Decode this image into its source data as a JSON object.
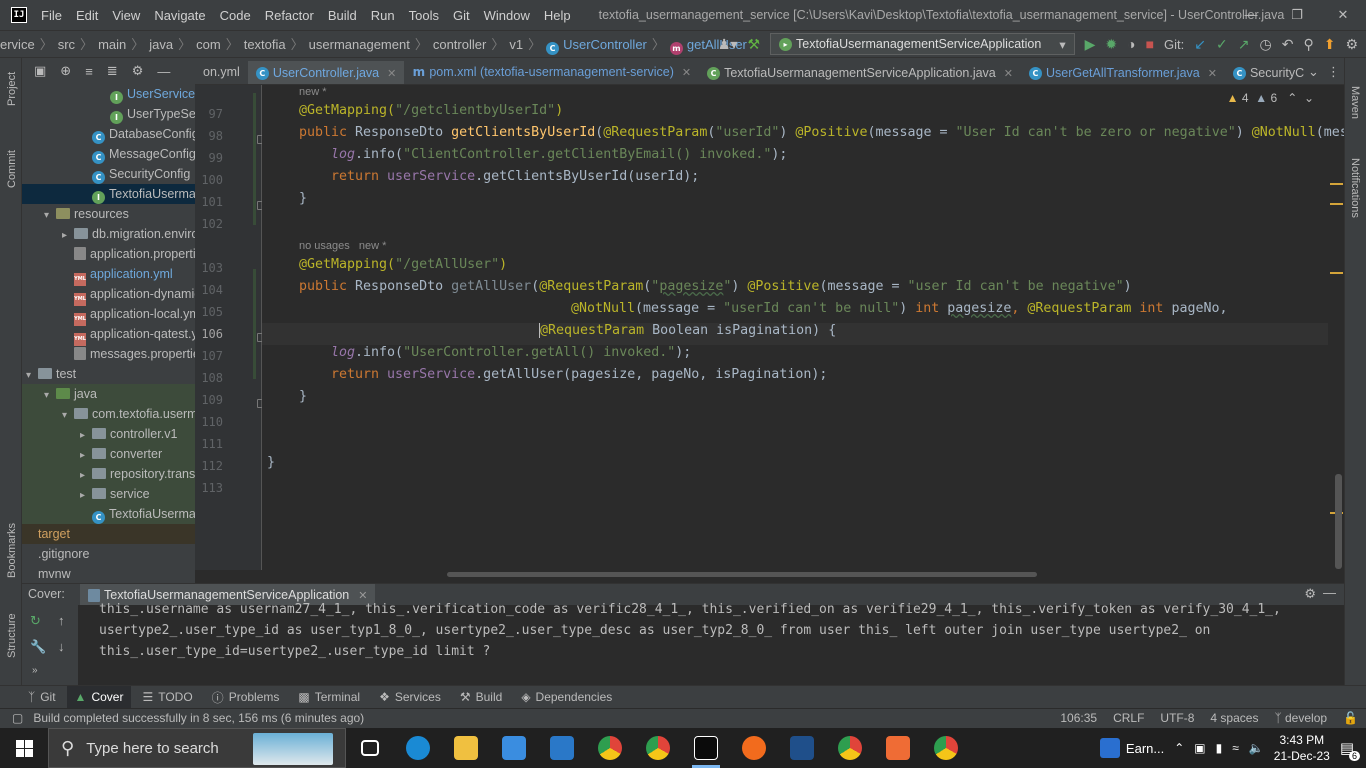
{
  "titlebar": {
    "menu": [
      "File",
      "Edit",
      "View",
      "Navigate",
      "Code",
      "Refactor",
      "Build",
      "Run",
      "Tools",
      "Git",
      "Window",
      "Help"
    ],
    "window_title": "textofia_usermanagement_service [C:\\Users\\Kavi\\Desktop\\Textofia\\textofia_usermanagement_service] - UserController.java"
  },
  "breadcrumb": [
    "ervice",
    "src",
    "main",
    "java",
    "com",
    "textofia",
    "usermanagement",
    "controller",
    "v1",
    "UserController",
    "getAllUser"
  ],
  "run_config": "TextofiaUsermanagementServiceApplication",
  "git_label": "Git:",
  "left_strip": [
    "Project",
    "Commit",
    "Bookmarks",
    "Structure"
  ],
  "right_strip": [
    "Maven",
    "Notifications"
  ],
  "project_tree": [
    {
      "label": "UserService",
      "icon": "g",
      "indent": 4,
      "color": "#6fa8dc"
    },
    {
      "label": "UserTypeService",
      "icon": "g",
      "indent": 4
    },
    {
      "label": "DatabaseConfig",
      "icon": "c",
      "indent": 3
    },
    {
      "label": "MessageConfig",
      "icon": "c",
      "indent": 3
    },
    {
      "label": "SecurityConfig",
      "icon": "c",
      "indent": 3
    },
    {
      "label": "TextofiaUsermanagementServiceApplication",
      "icon": "g",
      "indent": 3,
      "selected": true
    },
    {
      "label": "resources",
      "icon": "res",
      "indent": 1,
      "arrow": "open"
    },
    {
      "label": "db.migration.environment",
      "icon": "folder",
      "indent": 2,
      "arrow": "closed"
    },
    {
      "label": "application.properties",
      "icon": "props",
      "indent": 2
    },
    {
      "label": "application.yml",
      "icon": "yml",
      "indent": 2,
      "color": "#6fa8dc"
    },
    {
      "label": "application-dynamic.yml",
      "icon": "yml",
      "indent": 2
    },
    {
      "label": "application-local.yml",
      "icon": "yml",
      "indent": 2
    },
    {
      "label": "application-qatest.yml",
      "icon": "yml",
      "indent": 2
    },
    {
      "label": "messages.properties",
      "icon": "props",
      "indent": 2
    },
    {
      "label": "test",
      "icon": "folder",
      "indent": 0,
      "arrow": "open"
    },
    {
      "label": "java",
      "icon": "tst",
      "indent": 1,
      "arrow": "open",
      "green": true
    },
    {
      "label": "com.textofia.usermanagement",
      "icon": "folder",
      "indent": 2,
      "arrow": "open",
      "green": true
    },
    {
      "label": "controller.v1",
      "icon": "folder",
      "indent": 3,
      "arrow": "closed",
      "green": true
    },
    {
      "label": "converter",
      "icon": "folder",
      "indent": 3,
      "arrow": "closed",
      "green": true
    },
    {
      "label": "repository.transformer",
      "icon": "folder",
      "indent": 3,
      "arrow": "closed",
      "green": true
    },
    {
      "label": "service",
      "icon": "folder",
      "indent": 3,
      "arrow": "closed",
      "green": true
    },
    {
      "label": "TextofiaUsermanagementServiceApplicationTests",
      "icon": "c",
      "indent": 3,
      "green": true
    },
    {
      "label": "target",
      "icon": "none",
      "indent": 0,
      "color": "#d0a060",
      "target": true
    },
    {
      "label": ".gitignore",
      "icon": "none",
      "indent": 0
    },
    {
      "label": "mvnw",
      "icon": "none",
      "indent": 0
    }
  ],
  "tabs": [
    {
      "label": "on.yml",
      "kind": "yml",
      "closable": false
    },
    {
      "label": "UserController.java",
      "kind": "c",
      "active": true
    },
    {
      "label": "pom.xml (textofia-usermanagement-service)",
      "kind": "m",
      "blue": true
    },
    {
      "label": "TextofiaUsermanagementServiceApplication.java",
      "kind": "g"
    },
    {
      "label": "UserGetAllTransformer.java",
      "kind": "c",
      "blue": true
    },
    {
      "label": "SecurityCon",
      "kind": "c",
      "closable": false
    }
  ],
  "inspections": {
    "warnings": "4",
    "weak": "6"
  },
  "line_numbers": [
    "97",
    "98",
    "99",
    "100",
    "101",
    "102",
    "103",
    "104",
    "105",
    "106",
    "107",
    "108",
    "109",
    "110",
    "111",
    "112",
    "113"
  ],
  "hints": [
    {
      "text": "new *"
    },
    {
      "text": "no usages   new *"
    }
  ],
  "code": {
    "l97_annot": "@GetMapping(",
    "l97_str": "\"/getclientbyUserId\"",
    "l97_end": ")",
    "l98_pub": "public ",
    "l98_type": "ResponseDto ",
    "l98_name": "getClientsByUserId",
    "l98_p1": "(",
    "l98_a1": "@RequestParam",
    "l98_p2": "(",
    "l98_s1": "\"userId\"",
    "l98_p3": ") ",
    "l98_a2": "@Positive",
    "l98_p4": "(message = ",
    "l98_s2": "\"User Id can't be zero or negative\"",
    "l98_p5": ") ",
    "l98_a3": "@NotNull",
    "l98_p6": "(mes",
    "l99_log": "log",
    "l99_mid": ".info(",
    "l99_str": "\"ClientController.getClientByEmail() invoked.\"",
    "l99_end": ");",
    "l100_ret": "return ",
    "l100_f": "userService",
    "l100_rest": ".getClientsByUserId(userId);",
    "l101": "}",
    "l103_annot": "@GetMapping(",
    "l103_str": "\"/getAllUser\"",
    "l103_end": ")",
    "l104_pub": "public ",
    "l104_type": "ResponseDto ",
    "l104_name": "getAllUser",
    "l104_p1": "(",
    "l104_a1": "@RequestParam",
    "l104_p2": "(",
    "l104_s1q": "\"",
    "l104_s1": "pagesize",
    "l104_s1e": "\"",
    "l104_p3": ") ",
    "l104_a2": "@Positive",
    "l104_p4": "(message = ",
    "l104_s2": "\"user Id can't be negative\"",
    "l104_p5": ")",
    "l105_a": "@NotNull",
    "l105_p1": "(message = ",
    "l105_s": "\"userId can't be null\"",
    "l105_p2": ") ",
    "l105_int": "int ",
    "l105_v": "pagesize",
    "l105_c": ", ",
    "l105_a2": "@RequestParam ",
    "l105_int2": "int ",
    "l105_v2": "pageNo,",
    "l106_a": "@RequestParam ",
    "l106_rest": "Boolean isPagination) {",
    "l107_log": "log",
    "l107_mid": ".info(",
    "l107_str": "\"UserController.getAll() invoked.\"",
    "l107_end": ");",
    "l108_ret": "return ",
    "l108_f": "userService",
    "l108_rest": ".getAllUser(pagesize, pageNo, isPagination);",
    "l109": "}",
    "l112": "}"
  },
  "bottom_panel": {
    "label": "Cover:",
    "run_tab": "TextofiaUsermanagementServiceApplication",
    "console": [
      "this_.username as usernam27_4_1_, this_.verification_code as verific28_4_1_, this_.verified_on as verifie29_4_1_, this_.verify_token as verify_30_4_1_,",
      "usertype2_.user_type_id as user_typ1_8_0_, usertype2_.user_type_desc as user_typ2_8_0_ from user this_ left outer join user_type usertype2_ on",
      "this_.user_type_id=usertype2_.user_type_id limit ?"
    ]
  },
  "tool_windows": [
    {
      "label": "Git",
      "icon": "branch-icon"
    },
    {
      "label": "Cover",
      "icon": "cover-icon",
      "active": true
    },
    {
      "label": "TODO",
      "icon": "list-icon"
    },
    {
      "label": "Problems",
      "icon": "info-icon"
    },
    {
      "label": "Terminal",
      "icon": "terminal-icon"
    },
    {
      "label": "Services",
      "icon": "services-icon"
    },
    {
      "label": "Build",
      "icon": "hammer-icon"
    },
    {
      "label": "Dependencies",
      "icon": "layers-icon"
    }
  ],
  "status": {
    "message": "Build completed successfully in 8 sec, 156 ms (6 minutes ago)",
    "position": "106:35",
    "line_sep": "CRLF",
    "encoding": "UTF-8",
    "indent": "4 spaces",
    "branch": "develop"
  },
  "taskbar": {
    "search_placeholder": "Type here to search",
    "apps": [
      {
        "name": "task-view",
        "color": "#ffffff"
      },
      {
        "name": "edge",
        "color": "#1a8ad4"
      },
      {
        "name": "file-explorer",
        "color": "#f0c040"
      },
      {
        "name": "store",
        "color": "#3a8de0"
      },
      {
        "name": "mail",
        "color": "#2a78c8"
      },
      {
        "name": "chrome",
        "color": "#e0443a"
      },
      {
        "name": "chrome-profile",
        "color": "#e0443a"
      },
      {
        "name": "intellij",
        "color": "#0b0b0b",
        "active": true
      },
      {
        "name": "app-orange",
        "color": "#ffffff"
      },
      {
        "name": "app-blue",
        "color": "#1f4f8a"
      },
      {
        "name": "chrome-2",
        "color": "#e0443a"
      },
      {
        "name": "postman",
        "color": "#ef6c35"
      },
      {
        "name": "chrome-3",
        "color": "#e0443a"
      }
    ],
    "earn": "Earn...",
    "time": "3:43 PM",
    "date": "21-Dec-23",
    "notif_count": "6"
  },
  "colors": {
    "ide_bg": "#2b2b2b",
    "panel_bg": "#3c3f41",
    "keyword": "#cc7832",
    "string": "#6a8759",
    "annotation": "#bbb529",
    "method": "#ffc66d",
    "field": "#9876aa"
  }
}
